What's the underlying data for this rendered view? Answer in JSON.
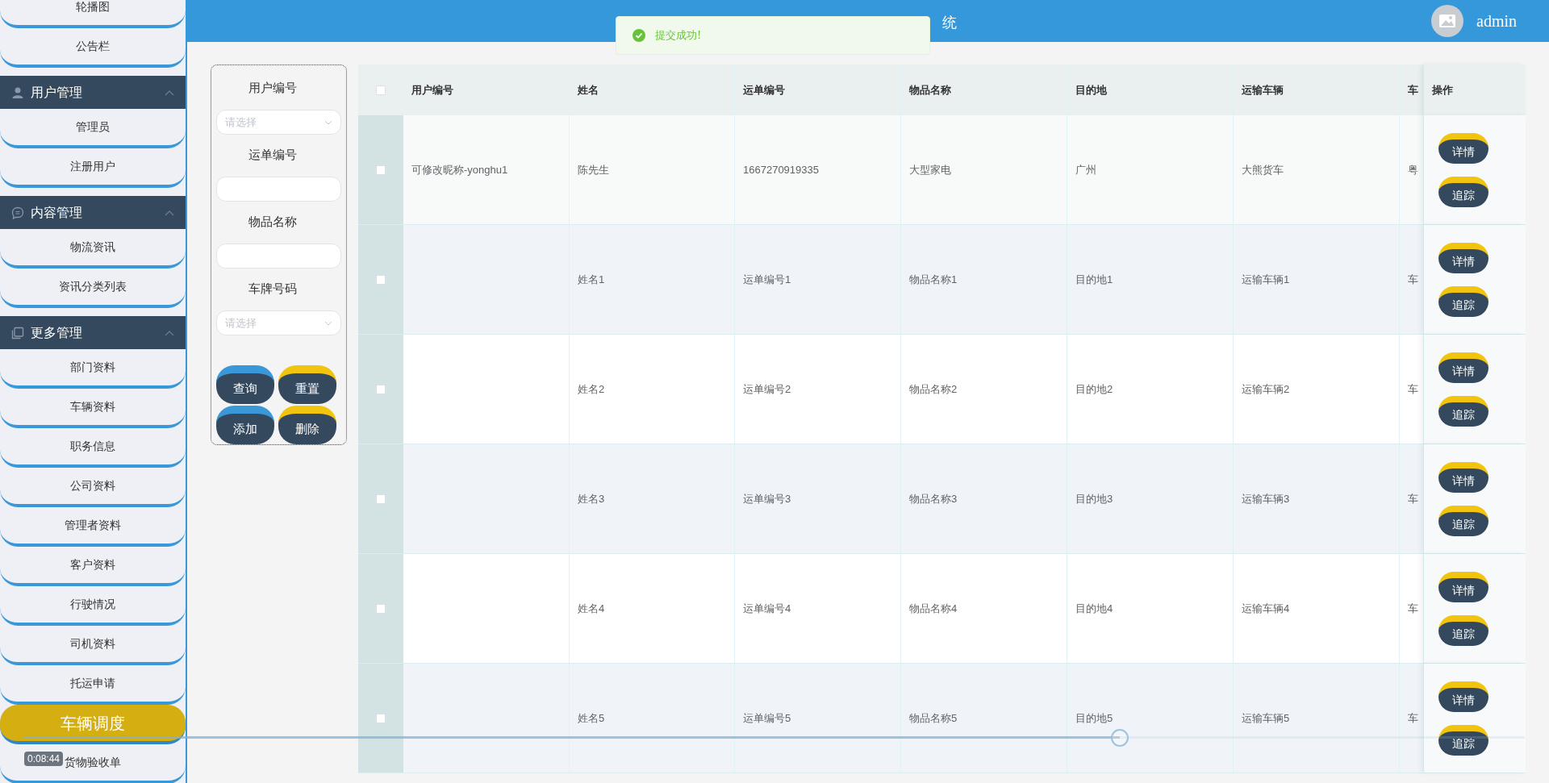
{
  "sidebar": {
    "menu": [
      {
        "kind": "item",
        "label": "轮播图",
        "selected": false
      },
      {
        "kind": "item",
        "label": "公告栏",
        "selected": false
      },
      {
        "kind": "group",
        "label": "用户管理",
        "expanded": true,
        "children": [
          {
            "label": "管理员",
            "selected": false
          },
          {
            "label": "注册用户",
            "selected": false
          }
        ]
      },
      {
        "kind": "group",
        "label": "内容管理",
        "expanded": true,
        "children": [
          {
            "label": "物流资讯",
            "selected": false
          },
          {
            "label": "资讯分类列表",
            "selected": false
          }
        ]
      },
      {
        "kind": "group",
        "label": "更多管理",
        "expanded": true,
        "children": [
          {
            "label": "部门资料",
            "selected": false
          },
          {
            "label": "车辆资料",
            "selected": false
          },
          {
            "label": "职务信息",
            "selected": false
          },
          {
            "label": "公司资料",
            "selected": false
          },
          {
            "label": "管理者资料",
            "selected": false
          },
          {
            "label": "客户资料",
            "selected": false
          },
          {
            "label": "行驶情况",
            "selected": false
          },
          {
            "label": "司机资料",
            "selected": false
          },
          {
            "label": "托运申请",
            "selected": false
          },
          {
            "label": "车辆调度",
            "selected": true
          },
          {
            "label": "货物验收单",
            "selected": false
          }
        ]
      }
    ]
  },
  "header": {
    "title": "统",
    "user": "admin"
  },
  "toast": {
    "message": "提交成功!"
  },
  "filter": {
    "fields": [
      {
        "kind": "select",
        "label": "用户编号",
        "placeholder": "请选择"
      },
      {
        "kind": "input",
        "label": "运单编号"
      },
      {
        "kind": "input",
        "label": "物品名称"
      },
      {
        "kind": "select",
        "label": "车牌号码",
        "placeholder": "请选择"
      }
    ],
    "buttons": [
      {
        "label": "查询",
        "color": "#3a98d8"
      },
      {
        "label": "重置",
        "color": "#f1c40f"
      },
      {
        "label": "添加",
        "color": "#3a98d8"
      },
      {
        "label": "删除",
        "color": "#f1c40f"
      }
    ]
  },
  "table": {
    "all_checked": false,
    "columns": [
      "用户编号",
      "姓名",
      "运单编号",
      "物品名称",
      "目的地",
      "运输车辆",
      "车"
    ],
    "action_column": "操作",
    "rows": [
      {
        "checked": false,
        "user_id": "可修改昵称-yonghu1",
        "name": "陈先生",
        "waybill_no": "1667270919335",
        "item_name": "大型家电",
        "destination": "广州",
        "vehicle": "大熊货车",
        "column_8": "粤",
        "actions": [
          "详情",
          "追踪"
        ]
      },
      {
        "checked": false,
        "name": "姓名1",
        "waybill_no": "运单编号1",
        "item_name": "物品名称1",
        "destination": "目的地1",
        "vehicle": "运输车辆1",
        "column_8": "车",
        "actions": [
          "详情",
          "追踪"
        ]
      },
      {
        "checked": false,
        "name": "姓名2",
        "waybill_no": "运单编号2",
        "item_name": "物品名称2",
        "destination": "目的地2",
        "vehicle": "运输车辆2",
        "column_8": "车",
        "actions": [
          "详情",
          "追踪"
        ]
      },
      {
        "checked": false,
        "name": "姓名3",
        "waybill_no": "运单编号3",
        "item_name": "物品名称3",
        "destination": "目的地3",
        "vehicle": "运输车辆3",
        "column_8": "车",
        "actions": [
          "详情",
          "追踪"
        ]
      },
      {
        "checked": false,
        "name": "姓名4",
        "waybill_no": "运单编号4",
        "item_name": "物品名称4",
        "destination": "目的地4",
        "vehicle": "运输车辆4",
        "column_8": "车",
        "actions": [
          "详情",
          "追踪"
        ]
      },
      {
        "checked": false,
        "name": "姓名5",
        "waybill_no": "运单编号5",
        "item_name": "物品名称5",
        "destination": "目的地5",
        "vehicle": "运输车辆5",
        "column_8": "车",
        "actions": [
          "详情",
          "追踪"
        ]
      }
    ]
  },
  "video_player": {
    "time": "0:08:44",
    "level": 0.73
  }
}
